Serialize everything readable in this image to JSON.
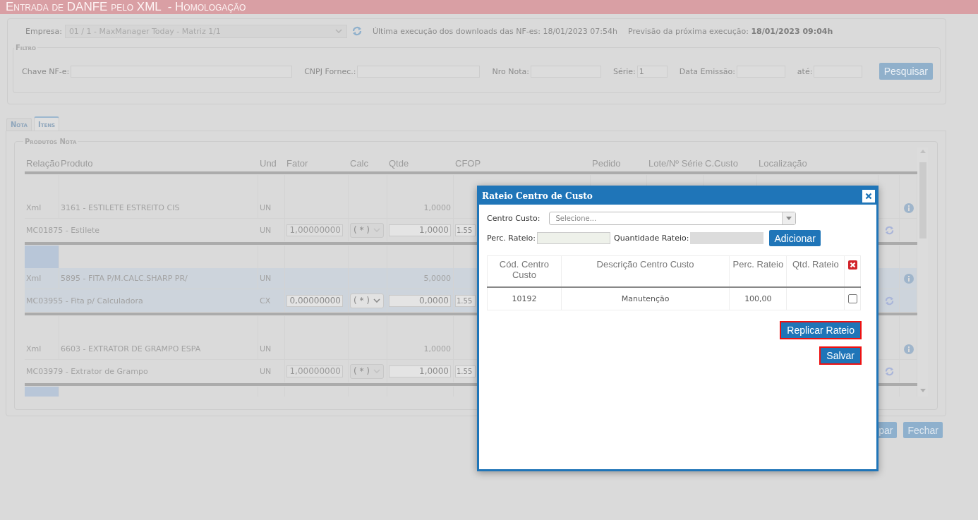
{
  "header": {
    "title": "Entrada de DANFE pelo XML  - Homologação"
  },
  "top": {
    "company_label": "Empresa:",
    "company_value": "01 / 1 - MaxManager Today - Matriz 1/1",
    "company_disabled": true,
    "last_run": "Última execução dos downloads das NF-es: 18/01/2023 07:54h",
    "next_run": "Previsão da próxima execução: **18/01/2023 09:04h**"
  },
  "filter": {
    "legend": "Filtro",
    "fields": [
      {
        "label": "Chave NF-e:"
      },
      {
        "label": "CNPJ Fornec.:"
      },
      {
        "label": "Nro Nota:"
      },
      {
        "label": "Série:",
        "value": "1"
      },
      {
        "label": "Data Emissão:"
      },
      {
        "label": "até:"
      }
    ],
    "button": "Pesquisar"
  },
  "tabs": [
    {
      "label": "Nota",
      "selected": false
    },
    {
      "label": "Itens",
      "selected": true
    }
  ],
  "products": {
    "legend": "Produtos Nota",
    "columns": [
      "Relação",
      "Produto",
      "Und",
      "Fator",
      "Calc",
      "Qtde",
      "CFOP",
      "Pedido",
      "Lote/Nº Série",
      "C.Custo",
      "Localização"
    ],
    "groups": [
      {
        "selected": false,
        "highlighted": false,
        "xml": {
          "relation": "Xml",
          "product": "3161 - ESTILETE ESTREITO CIS",
          "unit": "UN",
          "qty": "1,0000"
        },
        "item": {
          "product": "MC01875 - Estilete",
          "unit": "UN",
          "factor": "1,00000000",
          "calc": "( * )",
          "disabled": true,
          "qty": "1,0000",
          "cfop": "1.55"
        }
      },
      {
        "selected": true,
        "highlighted": true,
        "xml": {
          "relation": "Xml",
          "product": "5895 - FITA P/M.CALC.SHARP PR/",
          "unit": "UN",
          "qty": "5,0000"
        },
        "item": {
          "product": "MC03955 - Fita p/ Calculadora",
          "unit": "CX",
          "factor": "0,00000000",
          "calc": "( * )",
          "disabled": false,
          "qty": "0,0000",
          "cfop": "1.55"
        }
      },
      {
        "selected": false,
        "highlighted": false,
        "xml": {
          "relation": "Xml",
          "product": "6603 - EXTRATOR DE GRAMPO ESPA",
          "unit": "UN",
          "qty": "1,0000"
        },
        "item": {
          "product": "MC03979 - Extrator de Grampo",
          "unit": "UN",
          "factor": "1,00000000",
          "calc": "( * )",
          "disabled": true,
          "qty": "1,0000",
          "cfop": "1.55"
        }
      },
      {
        "highlighted": true
      }
    ]
  },
  "footer_buttons": [
    {
      "label": "par"
    },
    {
      "label": "Fechar"
    }
  ],
  "modal": {
    "title": "Rateio Centro de Custo",
    "center_label": "Centro Custo:",
    "center_placeholder": "Selecione...",
    "percent_label": "Perc. Rateio:",
    "quantity_label": "Quantidade Rateio:",
    "quantity_disabled": true,
    "add_button": "Adicionar",
    "columns": [
      "Cód. Centro Custo",
      "Descrição Centro Custo",
      "Perc. Rateio",
      "Qtd. Rateio"
    ],
    "rows": [
      {
        "code": "10192",
        "description": "Manutenção",
        "percent": "100,00",
        "checked": false
      }
    ],
    "buttons": [
      {
        "label": "Replicar Rateio",
        "highlighted": true
      },
      {
        "label": "Salvar",
        "highlighted": true
      }
    ]
  }
}
